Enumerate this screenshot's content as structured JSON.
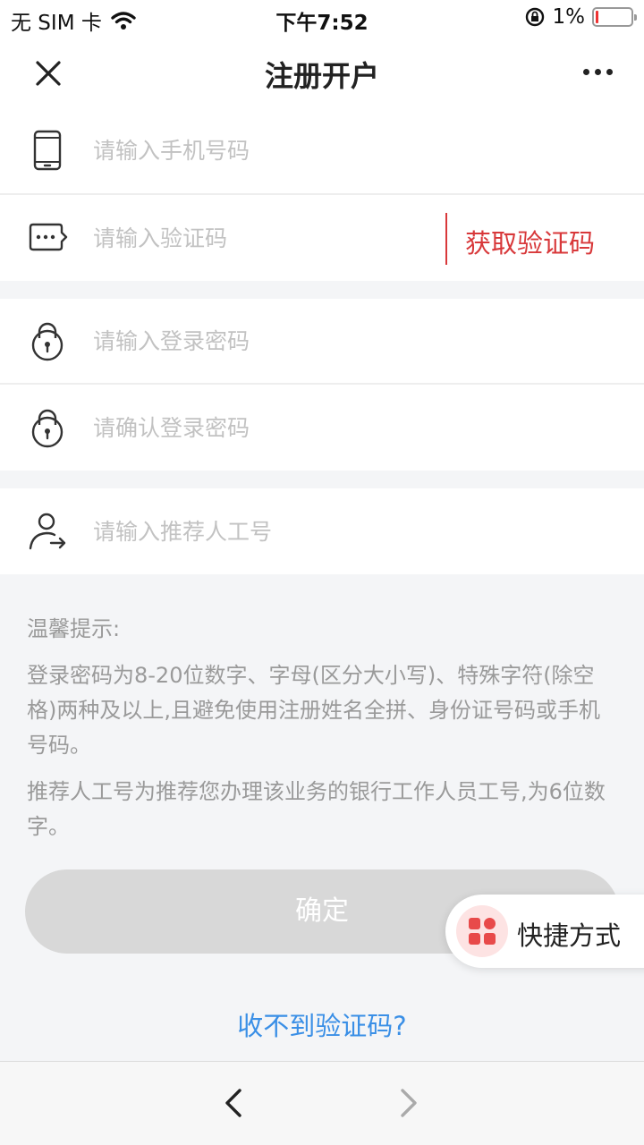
{
  "status_bar": {
    "carrier": "无 SIM 卡",
    "time": "下午7:52",
    "battery_percent": "1%",
    "battery_level": 0.03,
    "icons": [
      "wifi-icon",
      "rotation-lock-icon",
      "battery-icon"
    ]
  },
  "header": {
    "title": "注册开户",
    "close_icon": "close-icon",
    "more_icon": "more-icon"
  },
  "form": {
    "phone": {
      "placeholder": "请输入手机号码",
      "icon": "phone-icon"
    },
    "sms_code": {
      "placeholder": "请输入验证码",
      "icon": "message-icon",
      "get_code_label": "获取验证码"
    },
    "password": {
      "placeholder": "请输入登录密码",
      "icon": "lock-icon"
    },
    "confirm_password": {
      "placeholder": "请确认登录密码",
      "icon": "lock-icon"
    },
    "referrer": {
      "placeholder": "请输入推荐人工号",
      "icon": "user-icon"
    }
  },
  "tips": {
    "title": "温馨提示:",
    "password_rule": "登录密码为8-20位数字、字母(区分大小写)、特殊字符(除空格)两种及以上,且避免使用注册姓名全拼、身份证号码或手机号码。",
    "referrer_rule": "推荐人工号为推荐您办理该业务的银行工作人员工号,为6位数字。"
  },
  "confirm_button": "确定",
  "shortcut": {
    "label": "快捷方式",
    "icon": "grid-icon"
  },
  "no_code_link": "收不到验证码?",
  "bottom_nav": {
    "back_icon": "chevron-left-icon",
    "forward_icon": "chevron-right-icon"
  },
  "colors": {
    "accent_red": "#d8383a",
    "link_blue": "#3a8fe6",
    "disabled_button": "#d8d8d8",
    "placeholder": "#c2c2c2"
  }
}
